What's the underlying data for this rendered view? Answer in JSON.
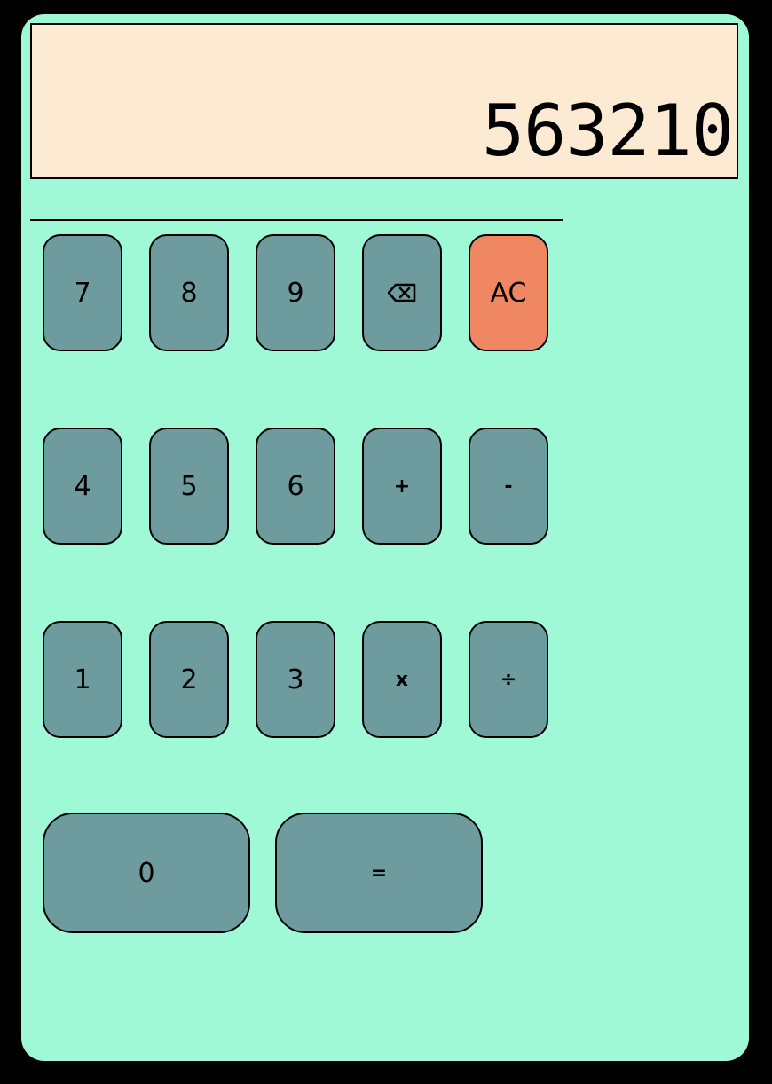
{
  "display": {
    "value": "563210"
  },
  "keys": {
    "seven": "7",
    "eight": "8",
    "nine": "9",
    "backspace_icon": "backspace-icon",
    "ac": "AC",
    "four": "4",
    "five": "5",
    "six": "6",
    "plus": "+",
    "minus": "-",
    "one": "1",
    "two": "2",
    "three": "3",
    "multiply": "x",
    "divide": "÷",
    "zero": "0",
    "equals": "="
  },
  "colors": {
    "body": "#a0f9d6",
    "display_bg": "#fdead3",
    "key": "#6e9c9e",
    "ac_key": "#ef8762",
    "frame": "#000000"
  }
}
